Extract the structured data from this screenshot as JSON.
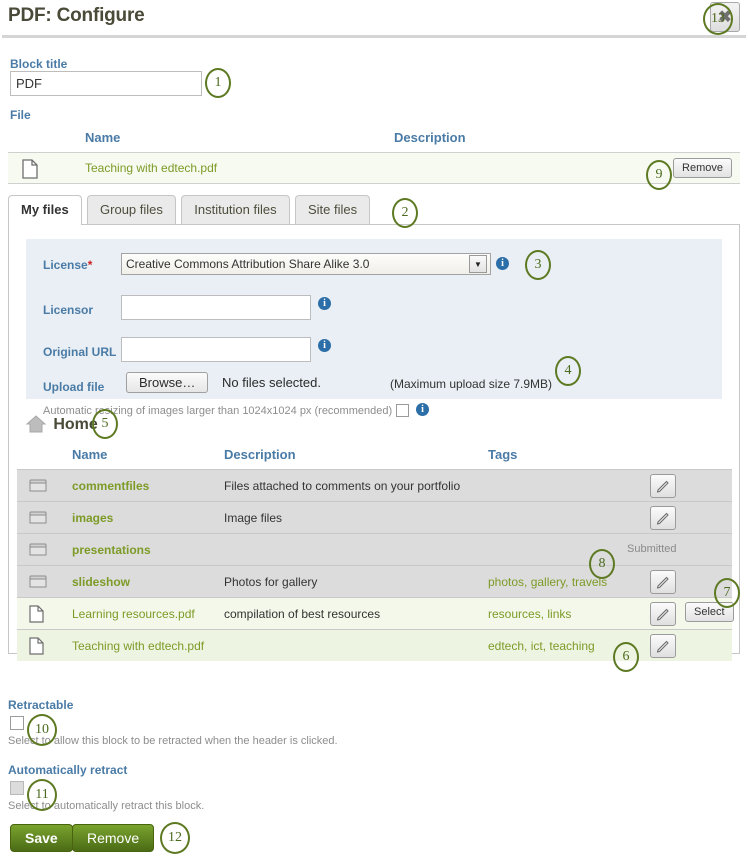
{
  "header": {
    "title": "PDF: Configure",
    "close_label": "✖"
  },
  "block_title": {
    "label": "Block title",
    "value": "PDF"
  },
  "file_section": {
    "label": "File",
    "columns": {
      "name": "Name",
      "description": "Description"
    },
    "selected_file": {
      "name": "Teaching with edtech.pdf",
      "remove_label": "Remove",
      "icon": "file-icon"
    }
  },
  "tabs": [
    {
      "label": "My files",
      "active": true
    },
    {
      "label": "Group files",
      "active": false
    },
    {
      "label": "Institution files",
      "active": false
    },
    {
      "label": "Site files",
      "active": false
    }
  ],
  "upload": {
    "license_label": "License",
    "license_required_mark": "*",
    "license_value": "Creative Commons Attribution Share Alike 3.0",
    "licensor_label": "Licensor",
    "licensor_value": "",
    "original_url_label": "Original URL",
    "original_url_value": "",
    "upload_file_label": "Upload file",
    "browse_label": "Browse…",
    "no_files_text": "No files selected.",
    "max_upload_text": "(Maximum upload size 7.9MB)",
    "resize_text": "Automatic resizing of images larger than 1024x1024 px (recommended)",
    "info_icon": "info-icon"
  },
  "breadcrumb": {
    "home_label": "Home",
    "home_icon": "home-icon"
  },
  "filelist": {
    "columns": {
      "name": "Name",
      "description": "Description",
      "tags": "Tags"
    },
    "rows": [
      {
        "type": "folder",
        "icon": "folder-icon",
        "name": "commentfiles",
        "description": "Files attached to comments on your portfolio",
        "tags": "",
        "status": "",
        "edit_label": "✎",
        "select_label": ""
      },
      {
        "type": "folder",
        "icon": "folder-icon",
        "name": "images",
        "description": "Image files",
        "tags": "",
        "status": "",
        "edit_label": "✎",
        "select_label": ""
      },
      {
        "type": "folder",
        "icon": "folder-icon",
        "name": "presentations",
        "description": "",
        "tags": "",
        "status": "Submitted",
        "edit_label": "",
        "select_label": ""
      },
      {
        "type": "folder",
        "icon": "folder-icon",
        "name": "slideshow",
        "description": "Photos for gallery",
        "tags": "photos, gallery, travels",
        "status": "",
        "edit_label": "✎",
        "select_label": ""
      },
      {
        "type": "file",
        "icon": "file-icon",
        "name": "Learning resources.pdf",
        "description": "compilation of best resources",
        "tags": "resources, links",
        "status": "",
        "edit_label": "✎",
        "select_label": "Select"
      },
      {
        "type": "file",
        "icon": "file-icon",
        "name": "Teaching with edtech.pdf",
        "description": "",
        "tags": "edtech, ict, teaching",
        "status": "",
        "edit_label": "✎",
        "select_label": ""
      }
    ]
  },
  "retractable": {
    "label": "Retractable",
    "help": "Select to allow this block to be retracted when the header is clicked.",
    "checked": false
  },
  "auto_retract": {
    "label": "Automatically retract",
    "help": "Select to automatically retract this block.",
    "checked": false,
    "disabled": true
  },
  "actions": {
    "save_label": "Save",
    "remove_label": "Remove"
  },
  "callouts": {
    "n1": "1",
    "n2": "2",
    "n3": "3",
    "n4": "4",
    "n5": "5",
    "n6": "6",
    "n7": "7",
    "n8": "8",
    "n9": "9",
    "n10": "10",
    "n11": "11",
    "n12": "12",
    "n13": "13"
  },
  "colors": {
    "label_blue": "#4a7ba6",
    "link_green": "#7d9b27",
    "button_green": "#7aa32e",
    "callout_green": "#5d7a23",
    "panel_blue": "#e9eff4",
    "folder_row": "#dcdcdc",
    "file_row": "#f4f8ea"
  }
}
